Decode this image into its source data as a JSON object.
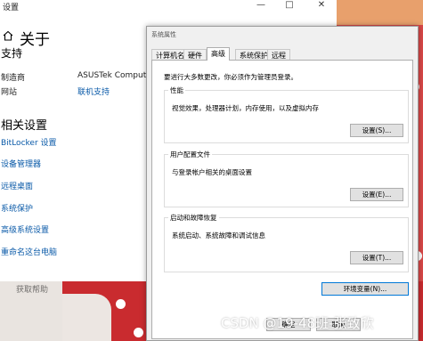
{
  "settings": {
    "window_title": "设置",
    "controls": {
      "minimize": "—",
      "maximize": "□",
      "close": "✕"
    },
    "page_title": "关于",
    "support_heading": "支持",
    "info": [
      {
        "label": "制造商",
        "value": "ASUSTek Computer",
        "is_link": false
      },
      {
        "label": "网站",
        "value": "联机支持",
        "is_link": true
      }
    ],
    "related_heading": "相关设置",
    "related_links": [
      "BitLocker 设置",
      "设备管理器",
      "远程桌面",
      "系统保护",
      "高级系统设置",
      "重命名这台电脑"
    ],
    "help_link": "获取帮助"
  },
  "dialog": {
    "title": "系统属性",
    "tabs": [
      "计算机名",
      "硬件",
      "高级",
      "系统保护",
      "远程"
    ],
    "active_tab": "高级",
    "intro": "要进行大多数更改，你必须作为管理员登录。",
    "groups": [
      {
        "label": "性能",
        "desc": "视觉效果，处理器计划，内存使用，以及虚拟内存",
        "button": "设置(S)..."
      },
      {
        "label": "用户配置文件",
        "desc": "与登录帐户相关的桌面设置",
        "button": "设置(E)..."
      },
      {
        "label": "启动和故障恢复",
        "desc": "系统启动、系统故障和调试信息",
        "button": "设置(T)..."
      }
    ],
    "env_button": "环境变量(N)...",
    "ok_button": "确定",
    "cancel_button": "取消"
  },
  "watermark": "CSDN @19-48班-张致欣",
  "colors": {
    "link": "#0a5aa8",
    "fabric_red": "#d94848",
    "focus_blue": "#0078d7"
  }
}
